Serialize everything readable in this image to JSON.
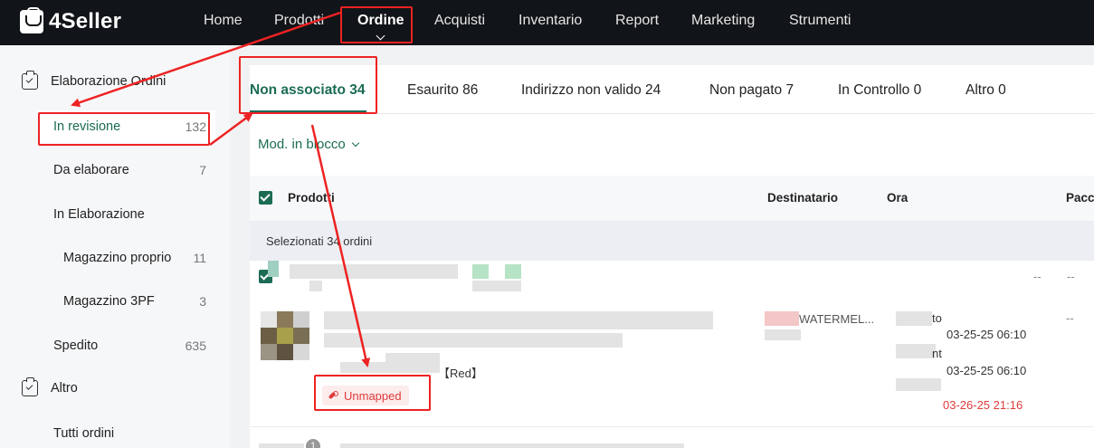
{
  "app": {
    "logo": "4Seller"
  },
  "nav": {
    "items": [
      {
        "label": "Home"
      },
      {
        "label": "Prodotti"
      },
      {
        "label": "Ordine",
        "active": true
      },
      {
        "label": "Acquisti"
      },
      {
        "label": "Inventario"
      },
      {
        "label": "Report"
      },
      {
        "label": "Marketing"
      },
      {
        "label": "Strumenti"
      }
    ]
  },
  "sidebar": {
    "group1": "Elaborazione Ordini",
    "items": [
      {
        "label": "In revisione",
        "count": "132",
        "active": true
      },
      {
        "label": "Da elaborare",
        "count": "7"
      },
      {
        "label": "In Elaborazione",
        "count": ""
      },
      {
        "label": "Magazzino proprio",
        "count": "11"
      },
      {
        "label": "Magazzino 3PF",
        "count": "3"
      },
      {
        "label": "Spedito",
        "count": "635"
      }
    ],
    "group2": "Altro",
    "extra": {
      "label": "Tutti ordini"
    }
  },
  "tabs": [
    {
      "label": "Non associato 34",
      "active": true
    },
    {
      "label": "Esaurito 86"
    },
    {
      "label": "Indirizzo non valido 24"
    },
    {
      "label": "Non pagato 7"
    },
    {
      "label": "In Controllo 0"
    },
    {
      "label": "Altro 0"
    }
  ],
  "toolbar": {
    "bulk_edit": "Mod. in blocco"
  },
  "table": {
    "headers": {
      "products": "Prodotti",
      "recipient": "Destinatario",
      "time": "Ora",
      "package": "Pacc"
    },
    "selection": "Selezionati 34 ordini",
    "row_a": {
      "dash1": "--",
      "dash2": "--"
    },
    "row_b": {
      "variant": "【Red】",
      "unmapped": "Unmapped",
      "recipient": "WATERMEL...",
      "time_label1": "to",
      "time1": "03-25-25 06:10",
      "time_label2": "nt",
      "time2": "03-25-25 06:10",
      "time3": "03-26-25 21:16",
      "dash": "--"
    },
    "row_c": {
      "badge": "1"
    }
  },
  "colors": {
    "accent": "#1b6b55",
    "annotation": "#ee2222",
    "topbar": "#111418",
    "error": "#e03b3b"
  }
}
